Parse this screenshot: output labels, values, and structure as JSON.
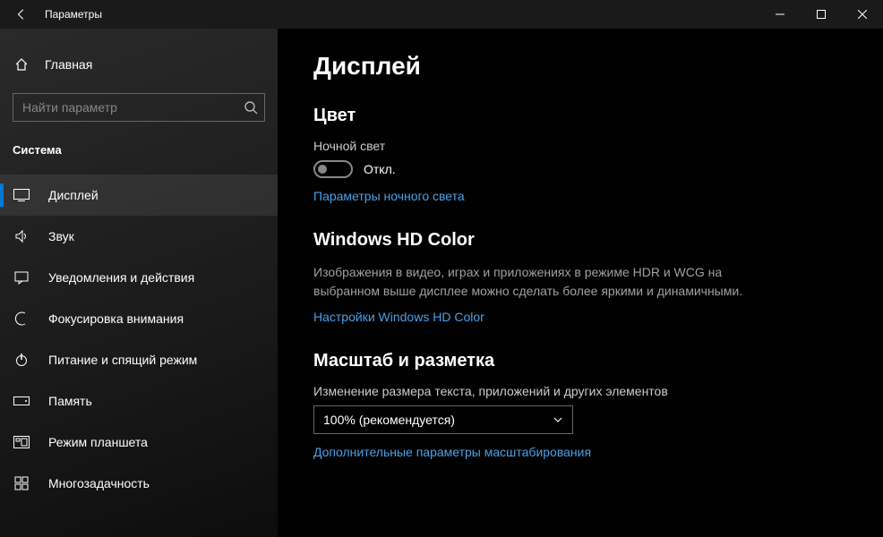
{
  "window": {
    "title": "Параметры"
  },
  "sidebar": {
    "home": "Главная",
    "search_placeholder": "Найти параметр",
    "section": "Система",
    "items": [
      {
        "label": "Дисплей"
      },
      {
        "label": "Звук"
      },
      {
        "label": "Уведомления и действия"
      },
      {
        "label": "Фокусировка внимания"
      },
      {
        "label": "Питание и спящий режим"
      },
      {
        "label": "Память"
      },
      {
        "label": "Режим планшета"
      },
      {
        "label": "Многозадачность"
      }
    ]
  },
  "main": {
    "title": "Дисплей",
    "color": {
      "heading": "Цвет",
      "night_light_label": "Ночной свет",
      "toggle_state": "Откл.",
      "link": "Параметры ночного света"
    },
    "hd": {
      "heading": "Windows HD Color",
      "desc": "Изображения в видео, играх и приложениях в режиме HDR и WCG на выбранном выше дисплее можно сделать более яркими и динамичными.",
      "link": "Настройки Windows HD Color"
    },
    "scale": {
      "heading": "Масштаб и разметка",
      "label": "Изменение размера текста, приложений и других элементов",
      "value": "100% (рекомендуется)",
      "link": "Дополнительные параметры масштабирования"
    }
  }
}
